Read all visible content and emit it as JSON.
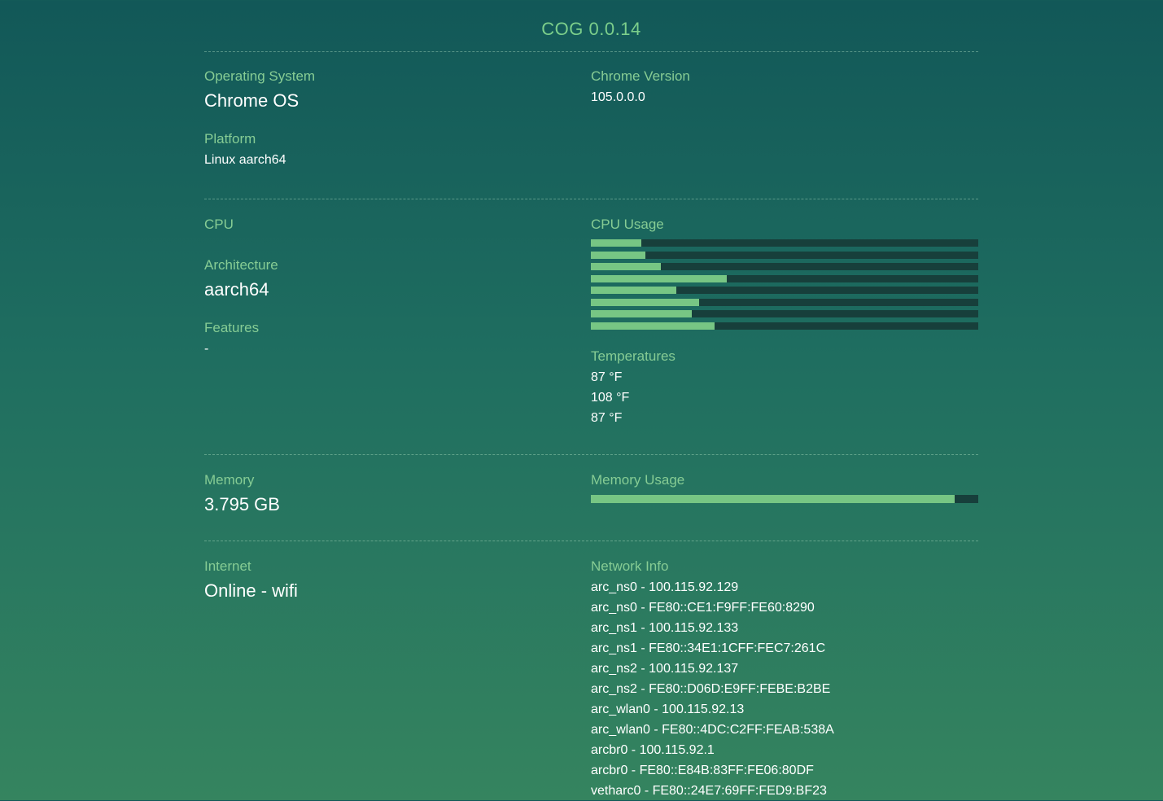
{
  "app": {
    "title": "COG 0.0.14"
  },
  "os_section": {
    "os_label": "Operating System",
    "os_value": "Chrome OS",
    "chrome_label": "Chrome Version",
    "chrome_value": "105.0.0.0",
    "platform_label": "Platform",
    "platform_value": "Linux aarch64"
  },
  "cpu_section": {
    "cpu_label": "CPU",
    "arch_label": "Architecture",
    "arch_value": "aarch64",
    "features_label": "Features",
    "features_value": "-",
    "usage_label": "CPU Usage",
    "usage_fractions": [
      0.13,
      0.14,
      0.18,
      0.35,
      0.22,
      0.28,
      0.26,
      0.32
    ],
    "temps_label": "Temperatures",
    "temps": [
      "87 °F",
      "108 °F",
      "87 °F"
    ]
  },
  "memory_section": {
    "memory_label": "Memory",
    "memory_value": "3.795 GB",
    "usage_label": "Memory Usage",
    "usage_fraction": 0.94
  },
  "network_section": {
    "internet_label": "Internet",
    "internet_value": "Online - wifi",
    "network_label": "Network Info",
    "entries": [
      "arc_ns0 - 100.115.92.129",
      "arc_ns0 - FE80::CE1:F9FF:FE60:8290",
      "arc_ns1 - 100.115.92.133",
      "arc_ns1 - FE80::34E1:1CFF:FEC7:261C",
      "arc_ns2 - 100.115.92.137",
      "arc_ns2 - FE80::D06D:E9FF:FEBE:B2BE",
      "arc_wlan0 - 100.115.92.13",
      "arc_wlan0 - FE80::4DC:C2FF:FEAB:538A",
      "arcbr0 - 100.115.92.1",
      "arcbr0 - FE80::E84B:83FF:FE06:80DF",
      "vetharc0 - FE80::24E7:69FF:FED9:BF23"
    ]
  },
  "colors": {
    "accent": "#7ccf8b",
    "bar_fill": "#77c684",
    "bar_track": "#173f3b"
  }
}
